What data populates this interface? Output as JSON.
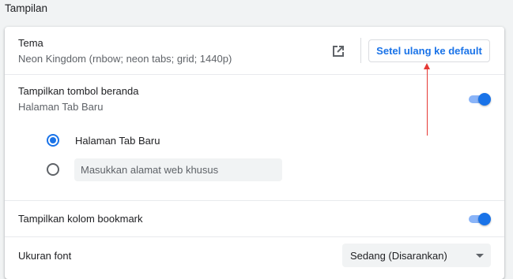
{
  "section": {
    "title": "Tampilan"
  },
  "theme": {
    "label": "Tema",
    "value": "Neon Kingdom (rnbow; neon tabs; grid; 1440p)",
    "open_icon": "open-in-new-icon",
    "reset_label": "Setel ulang ke default"
  },
  "home_button": {
    "label": "Tampilkan tombol beranda",
    "sublabel": "Halaman Tab Baru",
    "enabled": true,
    "options": [
      {
        "label": "Halaman Tab Baru",
        "checked": true
      },
      {
        "placeholder": "Masukkan alamat web khusus",
        "value": "",
        "checked": false
      }
    ]
  },
  "bookmark_bar": {
    "label": "Tampilkan kolom bookmark",
    "enabled": true
  },
  "font_size": {
    "label": "Ukuran font",
    "selected": "Sedang (Disarankan)"
  },
  "colors": {
    "accent": "#1a73e8",
    "annotation": "#e53935"
  }
}
